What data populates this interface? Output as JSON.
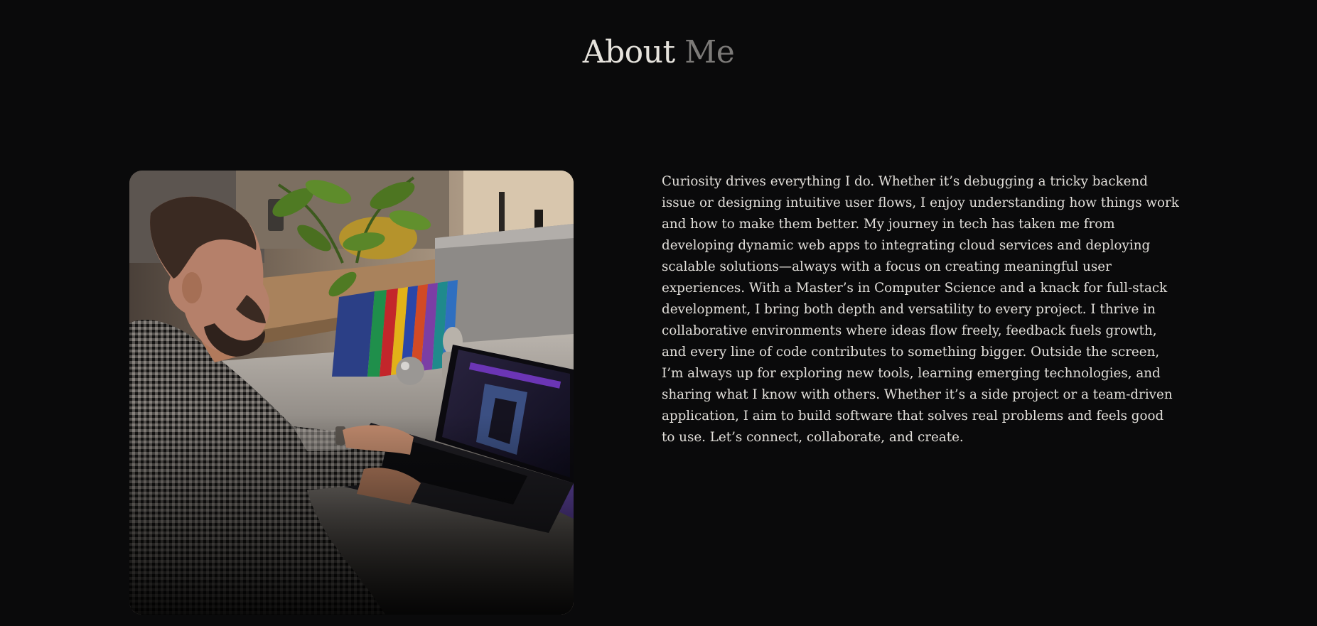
{
  "section": {
    "title_primary": "About",
    "title_accent": "Me"
  },
  "photo": {
    "icon": "portrait-photo"
  },
  "bio": {
    "text": "Curiosity drives everything I do. Whether it’s debugging a tricky backend issue or designing intuitive user flows, I enjoy understanding how things work and how to make them better. My journey in tech has taken me from developing dynamic web apps to integrating cloud services and deploying scalable solutions—always with a focus on creating meaningful user experiences. With a Master’s in Computer Science and a knack for full-stack development, I bring both depth and versatility to every project. I thrive in collaborative environments where ideas flow freely, feedback fuels growth, and every line of code contributes to something bigger. Outside the screen, I’m always up for exploring new tools, learning emerging technologies, and sharing what I know with others. Whether it’s a side project or a team-driven application, I aim to build software that solves real problems and feels good to use. Let’s connect, collaborate, and create."
  },
  "colors": {
    "background": "#0a0a0b",
    "title": "#e6e3dd",
    "title_accent": "#7c7a78",
    "body_text": "#e2dfda"
  }
}
